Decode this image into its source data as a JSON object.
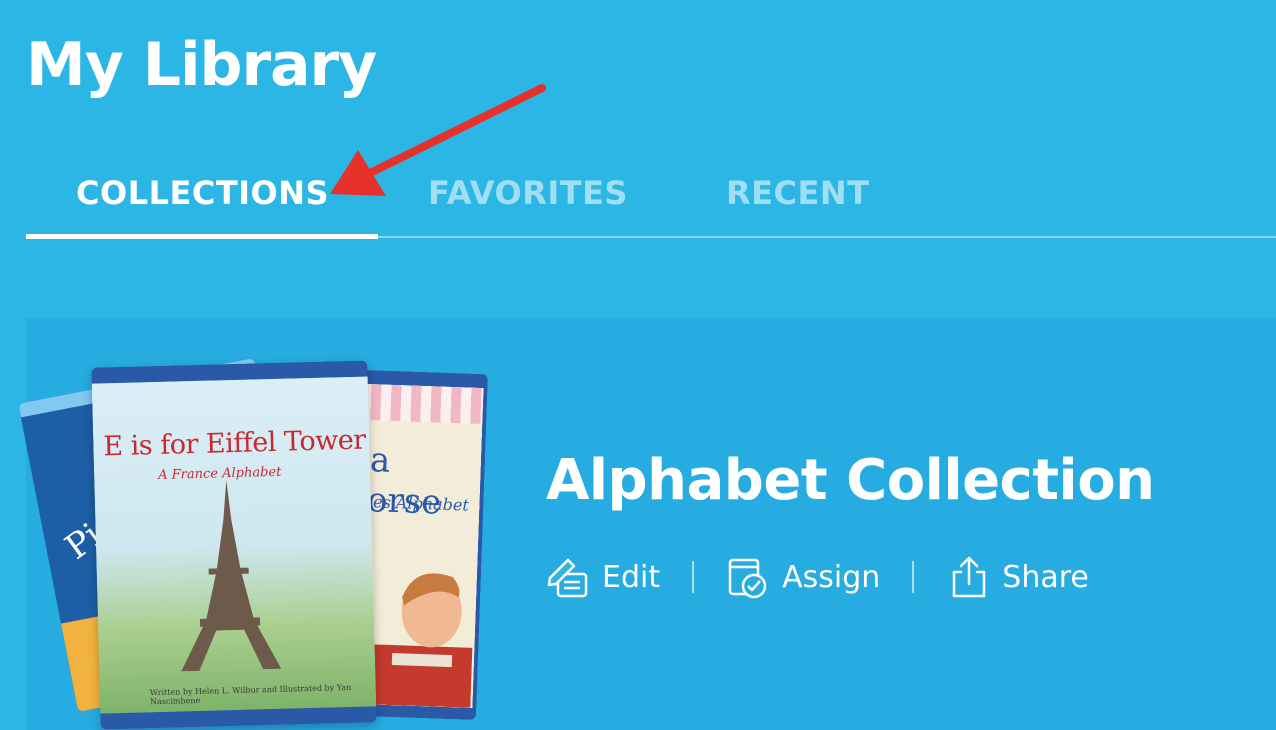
{
  "page": {
    "title": "My Library"
  },
  "tabs": [
    {
      "label": "COLLECTIONS",
      "active": true
    },
    {
      "label": "FAVORITES",
      "active": false
    },
    {
      "label": "RECENT",
      "active": false
    }
  ],
  "collection": {
    "title": "Alphabet Collection",
    "books": [
      {
        "title": "Pis"
      },
      {
        "title": "E is for Eiffel Tower",
        "subtitle": "A France Alphabet",
        "credit": "Written by Helen L. Wilbur and Illustrated by Yan Nascimbene"
      },
      {
        "title": "ala Horse",
        "subtitle": "untries Alphabet"
      }
    ],
    "actions": {
      "edit": {
        "label": "Edit",
        "icon": "edit-icon"
      },
      "assign": {
        "label": "Assign",
        "icon": "assign-icon"
      },
      "share": {
        "label": "Share",
        "icon": "share-icon"
      }
    }
  },
  "colors": {
    "background": "#2bb6e5",
    "card": "#26ace0",
    "annotation_arrow": "#e8302a"
  }
}
